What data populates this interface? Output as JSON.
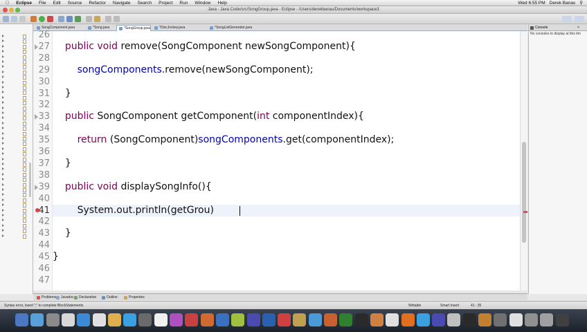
{
  "menubar": {
    "app": "Eclipse",
    "items": [
      "File",
      "Edit",
      "Source",
      "Refactor",
      "Navigate",
      "Search",
      "Project",
      "Run",
      "Window",
      "Help"
    ],
    "clock": "Wed 6:55 PM",
    "user": "Derek Banas"
  },
  "window": {
    "title": "Java - Java Code/src/SongGroup.java - Eclipse - /Users/derekbanas/Documents/workspace3"
  },
  "tabs": [
    {
      "label": "SongComponent.java",
      "active": false
    },
    {
      "label": "*Song.java",
      "active": false
    },
    {
      "label": "*SongGroup.java",
      "active": true
    },
    {
      "label": "*DiscJockey.java",
      "active": false
    },
    {
      "label": "*SongListGenerator.java",
      "active": false
    }
  ],
  "code": {
    "current_line": "41",
    "lines": [
      {
        "n": "26",
        "indent": "",
        "tokens": []
      },
      {
        "n": "27",
        "indent": "    ",
        "tokens": [
          [
            "kw",
            "public"
          ],
          [
            "t",
            " "
          ],
          [
            "kw",
            "void"
          ],
          [
            "t",
            " remove(SongComponent newSongComponent){"
          ]
        ]
      },
      {
        "n": "28",
        "indent": "",
        "tokens": []
      },
      {
        "n": "29",
        "indent": "        ",
        "tokens": [
          [
            "fld",
            "songComponents"
          ],
          [
            "t",
            ".remove(newSongComponent);"
          ]
        ]
      },
      {
        "n": "30",
        "indent": "",
        "tokens": []
      },
      {
        "n": "31",
        "indent": "    ",
        "tokens": [
          [
            "t",
            "}"
          ]
        ]
      },
      {
        "n": "32",
        "indent": "",
        "tokens": []
      },
      {
        "n": "33",
        "indent": "    ",
        "tokens": [
          [
            "kw",
            "public"
          ],
          [
            "t",
            " SongComponent getComponent("
          ],
          [
            "kw",
            "int"
          ],
          [
            "t",
            " componentIndex){"
          ]
        ]
      },
      {
        "n": "34",
        "indent": "",
        "tokens": []
      },
      {
        "n": "35",
        "indent": "        ",
        "tokens": [
          [
            "kw",
            "return"
          ],
          [
            "t",
            " (SongComponent)"
          ],
          [
            "fld",
            "songComponents"
          ],
          [
            "t",
            ".get(componentIndex);"
          ]
        ]
      },
      {
        "n": "36",
        "indent": "",
        "tokens": []
      },
      {
        "n": "37",
        "indent": "    ",
        "tokens": [
          [
            "t",
            "}"
          ]
        ]
      },
      {
        "n": "38",
        "indent": "",
        "tokens": []
      },
      {
        "n": "39",
        "indent": "    ",
        "tokens": [
          [
            "kw",
            "public"
          ],
          [
            "t",
            " "
          ],
          [
            "kw",
            "void"
          ],
          [
            "t",
            " displaySongInfo(){"
          ]
        ]
      },
      {
        "n": "40",
        "indent": "",
        "tokens": []
      },
      {
        "n": "41",
        "indent": "        ",
        "tokens": [
          [
            "t",
            "System.out.println(getGrou)"
          ]
        ]
      },
      {
        "n": "42",
        "indent": "",
        "tokens": []
      },
      {
        "n": "43",
        "indent": "    ",
        "tokens": [
          [
            "t",
            "}"
          ]
        ]
      },
      {
        "n": "44",
        "indent": "",
        "tokens": []
      },
      {
        "n": "45",
        "indent": "",
        "tokens": [
          [
            "t",
            "}"
          ]
        ]
      },
      {
        "n": "46",
        "indent": "",
        "tokens": []
      },
      {
        "n": "47",
        "indent": "",
        "tokens": []
      }
    ]
  },
  "console": {
    "tab": "Console",
    "message": "No consoles to display at this tim"
  },
  "bottom_tabs": [
    "Problems",
    "Javadoc",
    "Declaration",
    "Outline",
    "Properties"
  ],
  "status": {
    "message": "Syntax error, insert \";\" to complete BlockStatements",
    "writable": "Writable",
    "insert_mode": "Smart Insert",
    "position": "41 : 35"
  },
  "colors": {
    "keyword": "#7f0055",
    "field": "#0000c0",
    "current_line": "#eef2fb"
  }
}
